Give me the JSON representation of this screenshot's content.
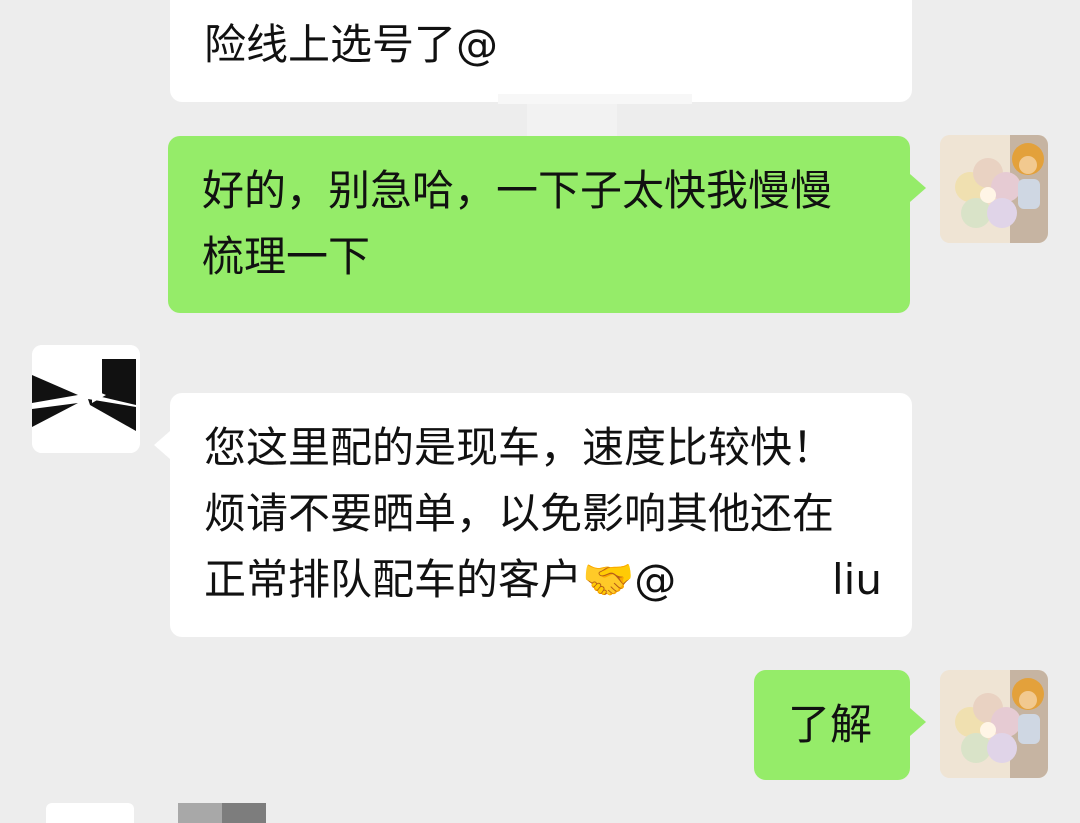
{
  "messages": [
    {
      "side": "left",
      "lines": [
        "险线上选号了@"
      ]
    },
    {
      "side": "right",
      "lines": [
        "好的，别急哈，一下子太快我慢慢",
        "梳理一下"
      ]
    },
    {
      "side": "left",
      "lines": [
        "您这里配的是现车，速度比较快！",
        "烦请不要晒单，以免影响其他还在",
        "正常排队配车的客户🤝@",
        "liu"
      ]
    },
    {
      "side": "right",
      "lines": [
        "了解"
      ]
    }
  ],
  "colors": {
    "incoming": "#ffffff",
    "outgoing": "#95ec69",
    "background": "#ededed"
  },
  "icons": {
    "brand_avatar": "x-logo-icon",
    "user_avatar": "flower-toy-avatar"
  }
}
